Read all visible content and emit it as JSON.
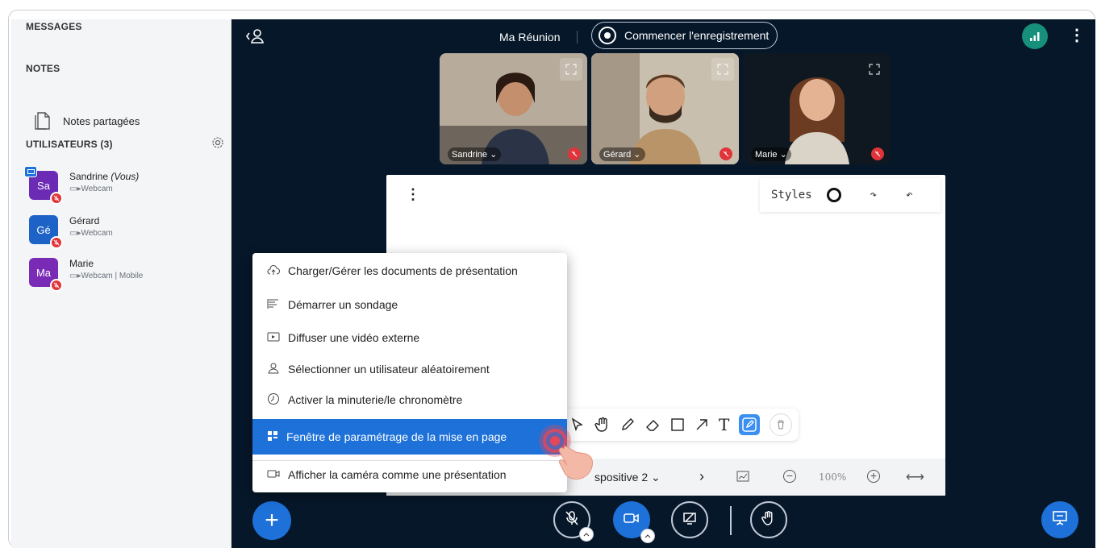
{
  "sidebar": {
    "messages_header": "MESSAGES",
    "notes_header": "NOTES",
    "shared_notes_label": "Notes partagées",
    "users_header": "UTILISATEURS (3)",
    "users": [
      {
        "initials": "Sa",
        "name": "Sandrine",
        "suffix": "(Vous)",
        "sub": "Webcam",
        "color": "#6b2bb5"
      },
      {
        "initials": "Gé",
        "name": "Gérard",
        "suffix": "",
        "sub": "Webcam",
        "color": "#1d63c7"
      },
      {
        "initials": "Ma",
        "name": "Marie",
        "suffix": "",
        "sub": "Webcam | Mobile",
        "color": "#7a2bb5"
      }
    ]
  },
  "header": {
    "meeting_title": "Ma Réunion",
    "record_label": "Commencer l'enregistrement"
  },
  "videos": [
    {
      "name": "Sandrine",
      "bg": "#8a7e72"
    },
    {
      "name": "Gérard",
      "bg": "#9a8a78"
    },
    {
      "name": "Marie",
      "bg": "#1d2c38"
    }
  ],
  "whiteboard": {
    "styles_label": "Styles",
    "slide_label": "spositive 2",
    "zoom_label": "100%"
  },
  "menu": {
    "items": [
      {
        "label": "Charger/Gérer les documents de présentation",
        "icon": "cloud-upload-icon"
      },
      {
        "label": "Démarrer un sondage",
        "icon": "poll-icon"
      },
      {
        "label": "Diffuser une vidéo externe",
        "icon": "video-icon"
      },
      {
        "label": "Sélectionner un utilisateur aléatoirement",
        "icon": "user-icon"
      },
      {
        "label": "Activer la minuterie/le chronomètre",
        "icon": "timer-icon"
      },
      {
        "label": "Fenêtre de paramétrage de la mise en page",
        "icon": "layout-icon"
      },
      {
        "label": "Afficher la caméra comme une présentation",
        "icon": "camera-icon"
      }
    ]
  },
  "colors": {
    "accent": "#1d71d8",
    "dark_bg": "#06172a",
    "mute_red": "#e0343a",
    "connection_green": "#16907a"
  }
}
